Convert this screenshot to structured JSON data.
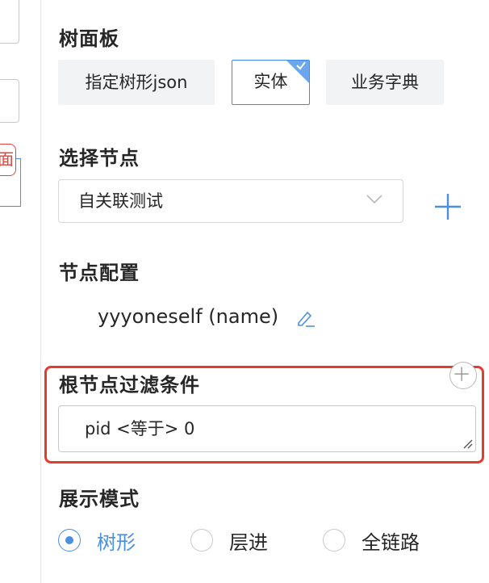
{
  "left_panel": {
    "tag_text": "面"
  },
  "tree_panel": {
    "title": "树面板",
    "options": [
      "指定树形json",
      "实体",
      "业务字典"
    ],
    "selected": "实体"
  },
  "node_select": {
    "title": "选择节点",
    "value": "自关联测试"
  },
  "node_config": {
    "title": "节点配置",
    "value": "yyyoneself (name)"
  },
  "root_filter": {
    "title": "根节点过滤条件",
    "value": "pid <等于> 0"
  },
  "display_mode": {
    "title": "展示模式",
    "options": [
      "树形",
      "层进",
      "全链路"
    ],
    "selected": "树形"
  },
  "colors": {
    "accent": "#4a90e2",
    "highlight": "#e33c2f"
  }
}
